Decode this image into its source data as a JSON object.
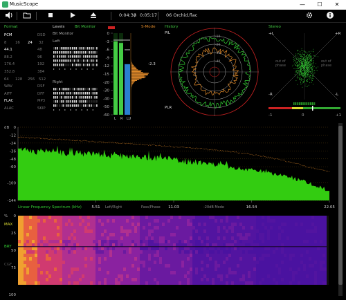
{
  "app": {
    "title": "MusicScope",
    "window_buttons": [
      "—",
      "☐",
      "✕"
    ]
  },
  "toolbar": {
    "position": "0:04:38",
    "separator": "/",
    "duration": "0:05:17",
    "track": "06 Orchid.flac"
  },
  "format": {
    "title": "Format",
    "rows": [
      [
        "PCM",
        "",
        "DSD"
      ],
      [
        "8",
        "16",
        "24",
        "32"
      ],
      [
        "44.1",
        "",
        "48"
      ],
      [
        "88.2",
        "",
        "96"
      ],
      [
        "176.4",
        "",
        "192"
      ],
      [
        "352.8",
        "",
        "384"
      ],
      [
        "64",
        "128",
        "256",
        "512"
      ],
      [
        "WAV",
        "",
        "DSF"
      ],
      [
        "AIFF",
        "",
        "DFF"
      ],
      [
        "FLAC",
        "",
        "MP3"
      ],
      [
        "ALAC",
        "",
        "SKIP"
      ]
    ]
  },
  "levels": {
    "title": "Levels",
    "mode": "Bit Monitor",
    "bit_monitor_label": "Bit Monitor",
    "left_label": "Left",
    "right_label": "Right"
  },
  "meter": {
    "mode": "S-Mode",
    "scale": [
      "0",
      "-3",
      "-6",
      "-9",
      "-12",
      "-15",
      "-20",
      "-30",
      "-40",
      "-50",
      "-60"
    ],
    "peak": "-2.3",
    "bottom_labels": [
      "L",
      "R",
      "LU"
    ],
    "left_level": 0.9,
    "right_level": 0.88,
    "loudness_level": 0.62
  },
  "history": {
    "title": "History",
    "top_label": "PlL",
    "bottom_label": "PLR"
  },
  "stereo": {
    "title": "Stereo",
    "corners": [
      "+L",
      "+R",
      "-R",
      "-L"
    ],
    "out_of_phase_left": "out of phase",
    "out_of_phase_right": "out of phase",
    "phase_scale": [
      "-1",
      "0",
      "+1"
    ]
  },
  "spectrum": {
    "y_unit": "dB",
    "y_ticks": [
      "0",
      "-12",
      "-24",
      "-36",
      "-48",
      "-60",
      "-100",
      "-144"
    ],
    "x_ticks": [
      "5.51",
      "11.03",
      "16.54",
      "22.05"
    ],
    "footer": "Linear Frequency Spectrum (kHz)",
    "footer_modes": [
      "Left/Right",
      "Pass/Phase",
      "-20dB Mode"
    ]
  },
  "spectrogram": {
    "y_unit": "%",
    "y_ticks": [
      "0",
      "25",
      "50",
      "75",
      "100"
    ],
    "side_labels": [
      "MAX",
      "BRY",
      "CGF"
    ]
  },
  "colors": {
    "accent": "#44cc44",
    "orange": "#e08a2a",
    "blue": "#2a7fd0",
    "red": "#cc2222"
  }
}
